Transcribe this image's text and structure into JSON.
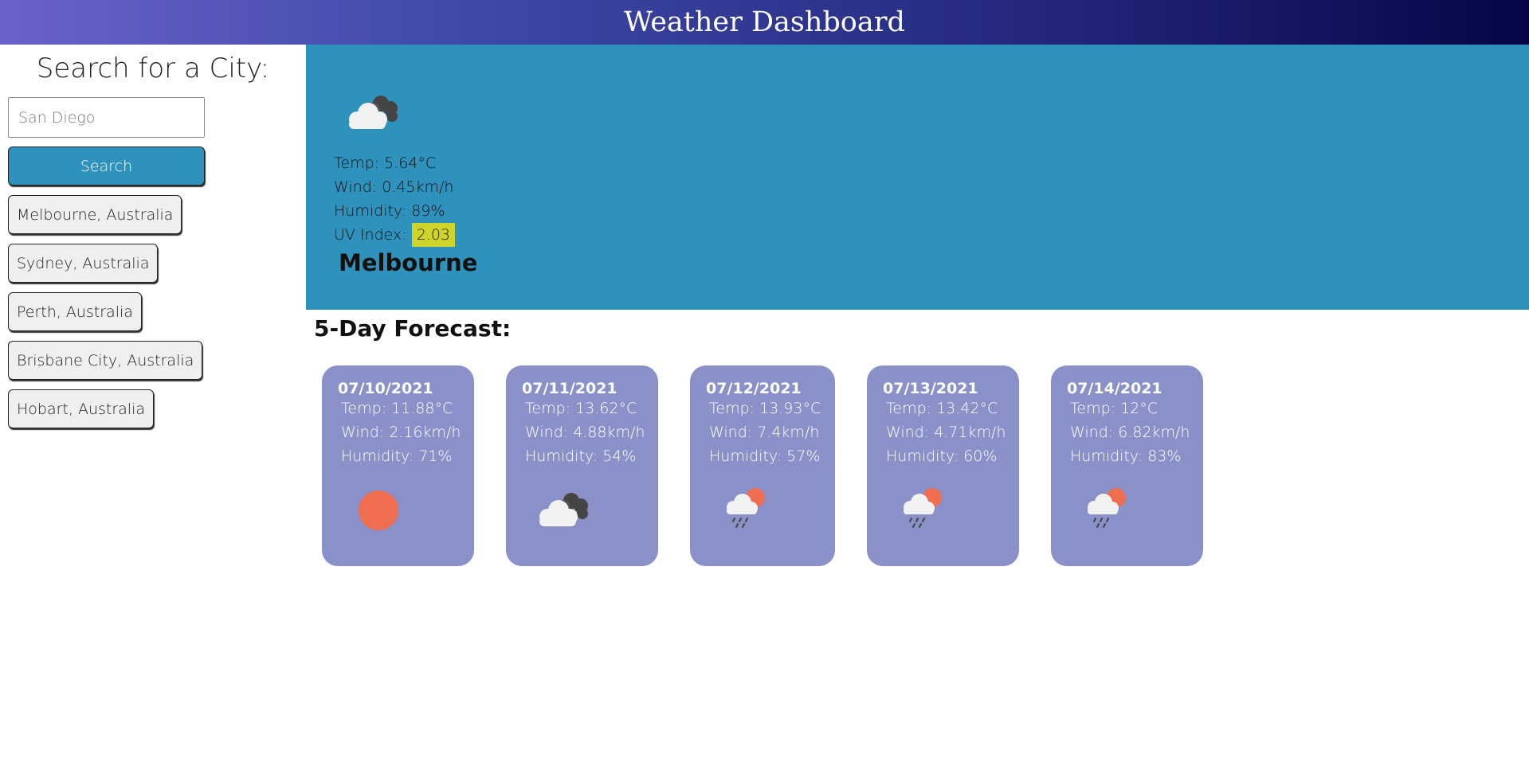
{
  "header": {
    "title": "Weather Dashboard"
  },
  "sidebar": {
    "heading": "Search for a City:",
    "search_placeholder": "San Diego",
    "search_button": "Search",
    "history": [
      "Melbourne, Australia",
      "Sydney, Australia",
      "Perth, Australia",
      "Brisbane City, Australia",
      "Hobart, Australia"
    ]
  },
  "current": {
    "icon": "cloudy-icon",
    "temp": "Temp: 5.64°C",
    "wind": "Wind: 0.45km/h",
    "humidity": "Humidity: 89%",
    "uv_label": "UV Index: ",
    "uv_value": "2.03",
    "city": "Melbourne"
  },
  "forecast": {
    "title": "5-Day Forecast:",
    "days": [
      {
        "date": "07/10/2021",
        "temp": "Temp: 11.88°C",
        "wind": "Wind: 2.16km/h",
        "humidity": "Humidity: 71%",
        "icon": "sun-icon"
      },
      {
        "date": "07/11/2021",
        "temp": "Temp: 13.62°C",
        "wind": "Wind: 4.88km/h",
        "humidity": "Humidity: 54%",
        "icon": "cloudy-icon"
      },
      {
        "date": "07/12/2021",
        "temp": "Temp: 13.93°C",
        "wind": "Wind: 7.4km/h",
        "humidity": "Humidity: 57%",
        "icon": "rain-sun-icon"
      },
      {
        "date": "07/13/2021",
        "temp": "Temp: 13.42°C",
        "wind": "Wind: 4.71km/h",
        "humidity": "Humidity: 60%",
        "icon": "rain-sun-icon"
      },
      {
        "date": "07/14/2021",
        "temp": "Temp: 12°C",
        "wind": "Wind: 6.82km/h",
        "humidity": "Humidity: 83%",
        "icon": "rain-sun-icon"
      }
    ]
  },
  "colors": {
    "header_start": "#6a63c9",
    "header_end": "#050548",
    "current_bg": "#2f92bc",
    "card_bg": "#8a91c8",
    "uv_badge": "#cfd42a",
    "sun": "#ee6e4f"
  }
}
